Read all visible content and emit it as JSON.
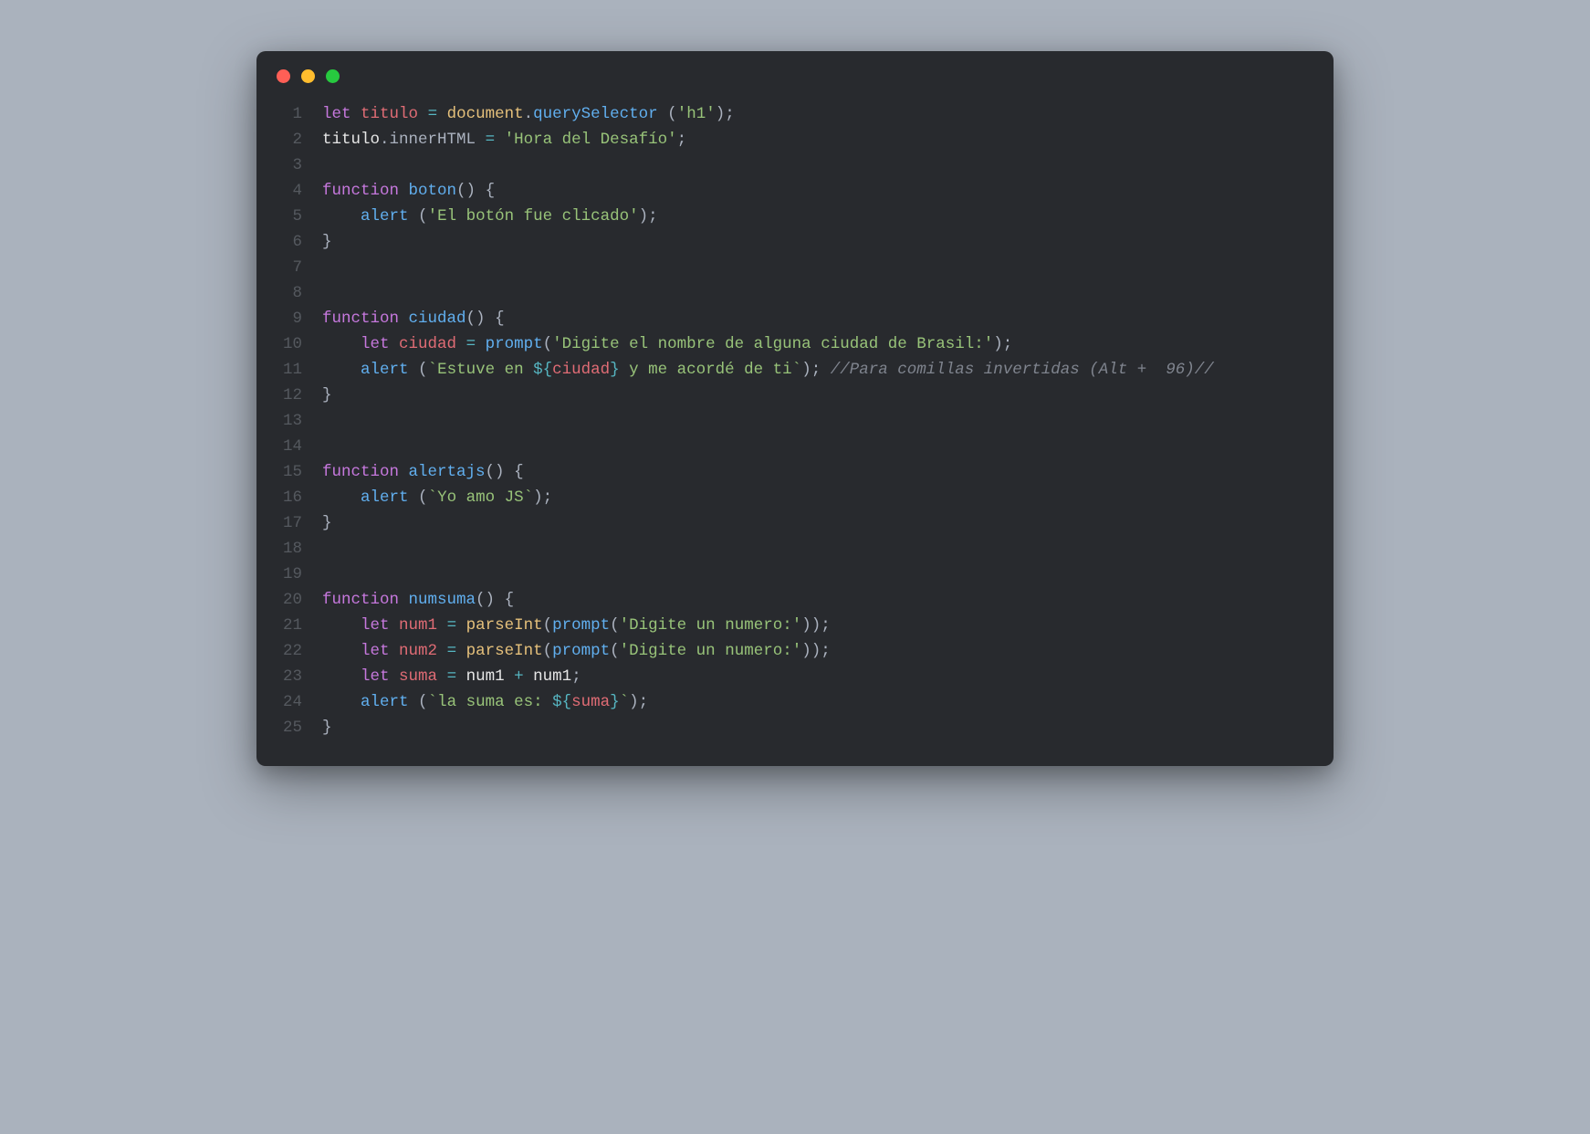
{
  "window": {
    "controls": [
      "close",
      "minimize",
      "zoom"
    ]
  },
  "code": {
    "lines": [
      {
        "n": 1,
        "tokens": [
          [
            "kw",
            "let"
          ],
          [
            "sp",
            " "
          ],
          [
            "def",
            "titulo"
          ],
          [
            "sp",
            " "
          ],
          [
            "op",
            "="
          ],
          [
            "sp",
            " "
          ],
          [
            "builtin",
            "document"
          ],
          [
            "punct",
            "."
          ],
          [
            "func",
            "querySelector"
          ],
          [
            "sp",
            " "
          ],
          [
            "punct",
            "("
          ],
          [
            "str",
            "'h1'"
          ],
          [
            "punct",
            ")"
          ],
          [
            "punct",
            ";"
          ]
        ]
      },
      {
        "n": 2,
        "tokens": [
          [
            "ident",
            "titulo"
          ],
          [
            "punct",
            "."
          ],
          [
            "prop",
            "innerHTML"
          ],
          [
            "sp",
            " "
          ],
          [
            "op",
            "="
          ],
          [
            "sp",
            " "
          ],
          [
            "str",
            "'Hora del Desafío'"
          ],
          [
            "punct",
            ";"
          ]
        ]
      },
      {
        "n": 3,
        "tokens": []
      },
      {
        "n": 4,
        "tokens": [
          [
            "kw",
            "function"
          ],
          [
            "sp",
            " "
          ],
          [
            "func",
            "boton"
          ],
          [
            "punct",
            "()"
          ],
          [
            "sp",
            " "
          ],
          [
            "punct",
            "{"
          ]
        ]
      },
      {
        "n": 5,
        "tokens": [
          [
            "sp",
            "    "
          ],
          [
            "func",
            "alert"
          ],
          [
            "sp",
            " "
          ],
          [
            "punct",
            "("
          ],
          [
            "str",
            "'El botón fue clicado'"
          ],
          [
            "punct",
            ")"
          ],
          [
            "punct",
            ";"
          ]
        ]
      },
      {
        "n": 6,
        "tokens": [
          [
            "punct",
            "}"
          ]
        ]
      },
      {
        "n": 7,
        "tokens": []
      },
      {
        "n": 8,
        "tokens": []
      },
      {
        "n": 9,
        "tokens": [
          [
            "kw",
            "function"
          ],
          [
            "sp",
            " "
          ],
          [
            "func",
            "ciudad"
          ],
          [
            "punct",
            "()"
          ],
          [
            "sp",
            " "
          ],
          [
            "punct",
            "{"
          ]
        ]
      },
      {
        "n": 10,
        "tokens": [
          [
            "sp",
            "    "
          ],
          [
            "kw",
            "let"
          ],
          [
            "sp",
            " "
          ],
          [
            "def",
            "ciudad"
          ],
          [
            "sp",
            " "
          ],
          [
            "op",
            "="
          ],
          [
            "sp",
            " "
          ],
          [
            "func",
            "prompt"
          ],
          [
            "punct",
            "("
          ],
          [
            "str",
            "'Digite el nombre de alguna ciudad de Brasil:'"
          ],
          [
            "punct",
            ")"
          ],
          [
            "punct",
            ";"
          ]
        ]
      },
      {
        "n": 11,
        "tokens": [
          [
            "sp",
            "    "
          ],
          [
            "func",
            "alert"
          ],
          [
            "sp",
            " "
          ],
          [
            "punct",
            "("
          ],
          [
            "tmpl",
            "`Estuve en "
          ],
          [
            "tmpldlm",
            "${"
          ],
          [
            "tmplvar",
            "ciudad"
          ],
          [
            "tmpldlm",
            "}"
          ],
          [
            "tmpl",
            " y me acordé de ti`"
          ],
          [
            "punct",
            ")"
          ],
          [
            "punct",
            ";"
          ],
          [
            "sp",
            " "
          ],
          [
            "comment",
            "//Para comillas invertidas (Alt +  96)//"
          ]
        ]
      },
      {
        "n": 12,
        "tokens": [
          [
            "punct",
            "}"
          ]
        ]
      },
      {
        "n": 13,
        "tokens": []
      },
      {
        "n": 14,
        "tokens": []
      },
      {
        "n": 15,
        "tokens": [
          [
            "kw",
            "function"
          ],
          [
            "sp",
            " "
          ],
          [
            "func",
            "alertajs"
          ],
          [
            "punct",
            "()"
          ],
          [
            "sp",
            " "
          ],
          [
            "punct",
            "{"
          ]
        ]
      },
      {
        "n": 16,
        "tokens": [
          [
            "sp",
            "    "
          ],
          [
            "func",
            "alert"
          ],
          [
            "sp",
            " "
          ],
          [
            "punct",
            "("
          ],
          [
            "tmpl",
            "`Yo amo JS`"
          ],
          [
            "punct",
            ")"
          ],
          [
            "punct",
            ";"
          ]
        ]
      },
      {
        "n": 17,
        "tokens": [
          [
            "punct",
            "}"
          ]
        ]
      },
      {
        "n": 18,
        "tokens": []
      },
      {
        "n": 19,
        "tokens": []
      },
      {
        "n": 20,
        "tokens": [
          [
            "kw",
            "function"
          ],
          [
            "sp",
            " "
          ],
          [
            "func",
            "numsuma"
          ],
          [
            "punct",
            "()"
          ],
          [
            "sp",
            " "
          ],
          [
            "punct",
            "{"
          ]
        ]
      },
      {
        "n": 21,
        "tokens": [
          [
            "sp",
            "    "
          ],
          [
            "kw",
            "let"
          ],
          [
            "sp",
            " "
          ],
          [
            "def",
            "num1"
          ],
          [
            "sp",
            " "
          ],
          [
            "op",
            "="
          ],
          [
            "sp",
            " "
          ],
          [
            "builtin",
            "parseInt"
          ],
          [
            "punct",
            "("
          ],
          [
            "func",
            "prompt"
          ],
          [
            "punct",
            "("
          ],
          [
            "str",
            "'Digite un numero:'"
          ],
          [
            "punct",
            "))"
          ],
          [
            "punct",
            ";"
          ]
        ]
      },
      {
        "n": 22,
        "tokens": [
          [
            "sp",
            "    "
          ],
          [
            "kw",
            "let"
          ],
          [
            "sp",
            " "
          ],
          [
            "def",
            "num2"
          ],
          [
            "sp",
            " "
          ],
          [
            "op",
            "="
          ],
          [
            "sp",
            " "
          ],
          [
            "builtin",
            "parseInt"
          ],
          [
            "punct",
            "("
          ],
          [
            "func",
            "prompt"
          ],
          [
            "punct",
            "("
          ],
          [
            "str",
            "'Digite un numero:'"
          ],
          [
            "punct",
            "))"
          ],
          [
            "punct",
            ";"
          ]
        ]
      },
      {
        "n": 23,
        "tokens": [
          [
            "sp",
            "    "
          ],
          [
            "kw",
            "let"
          ],
          [
            "sp",
            " "
          ],
          [
            "def",
            "suma"
          ],
          [
            "sp",
            " "
          ],
          [
            "op",
            "="
          ],
          [
            "sp",
            " "
          ],
          [
            "ident",
            "num1"
          ],
          [
            "sp",
            " "
          ],
          [
            "op",
            "+"
          ],
          [
            "sp",
            " "
          ],
          [
            "ident",
            "num1"
          ],
          [
            "punct",
            ";"
          ]
        ]
      },
      {
        "n": 24,
        "tokens": [
          [
            "sp",
            "    "
          ],
          [
            "func",
            "alert"
          ],
          [
            "sp",
            " "
          ],
          [
            "punct",
            "("
          ],
          [
            "tmpl",
            "`la suma es: "
          ],
          [
            "tmpldlm",
            "${"
          ],
          [
            "tmplvar",
            "suma"
          ],
          [
            "tmpldlm",
            "}"
          ],
          [
            "tmpl",
            "`"
          ],
          [
            "punct",
            ")"
          ],
          [
            "punct",
            ";"
          ]
        ]
      },
      {
        "n": 25,
        "tokens": [
          [
            "punct",
            "}"
          ]
        ]
      }
    ]
  }
}
